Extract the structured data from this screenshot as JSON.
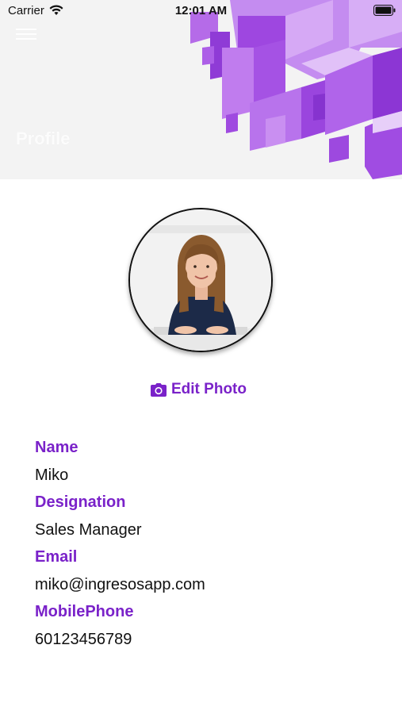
{
  "status_bar": {
    "carrier": "Carrier",
    "time": "12:01 AM"
  },
  "header": {
    "title": "Profile",
    "accent_color": "#a75ce0"
  },
  "profile": {
    "edit_photo_label": "Edit Photo",
    "fields": [
      {
        "label": "Name",
        "value": "Miko"
      },
      {
        "label": "Designation",
        "value": "Sales Manager"
      },
      {
        "label": "Email",
        "value": "miko@ingresosapp.com"
      },
      {
        "label": "MobilePhone",
        "value": "60123456789"
      }
    ]
  },
  "colors": {
    "label": "#7a22c9",
    "value": "#111111"
  }
}
